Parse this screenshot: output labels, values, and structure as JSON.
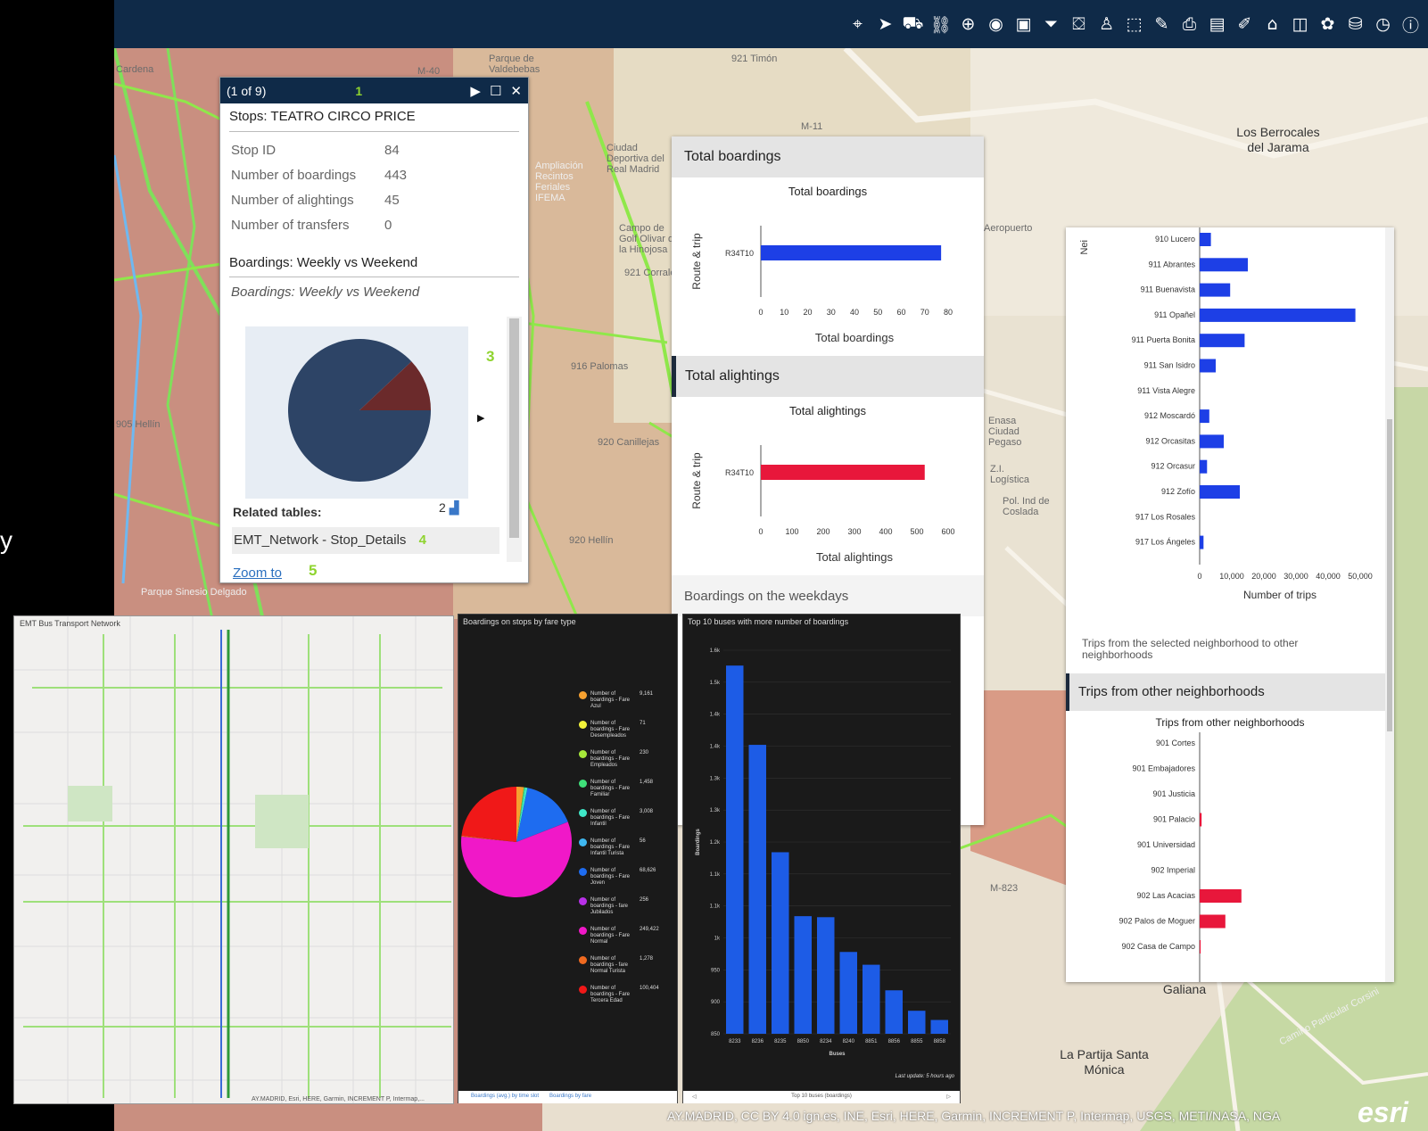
{
  "toolbar": {
    "icons": [
      "locate-icon",
      "directions-icon",
      "bus-icon",
      "link-icon",
      "add-icon",
      "bookmark-icon",
      "bus-stop-icon",
      "filter-icon",
      "transit-icon",
      "person-icon",
      "select-icon",
      "measure-icon",
      "print-icon",
      "table-icon",
      "edit-icon",
      "education-icon",
      "layer-icon",
      "basemap-icon",
      "stats-icon",
      "time-icon",
      "info-icon"
    ]
  },
  "map": {
    "labels": [
      "Cardena",
      "Parque de Valdebebas",
      "921 Timón",
      "M-40",
      "M-11",
      "Los Berrocales del Jarama",
      "Ampliación Recintos Feriales IFEMA",
      "Ciudad Deportiva del Real Madrid",
      "Campo de Golf Olivar de la Hinojosa",
      "921 Corralejos",
      "916 Palomas",
      "920 Canillejas",
      "920 Hellín",
      "905 Hellín",
      "Aeropuerto",
      "Enasa Ciudad Pegaso",
      "Z.I. Logística",
      "Pol. Ind de Coslada",
      "Real de la Galiana",
      "La Partija Santa Mónica",
      "Camino Particular Corsini",
      "Parque Sinesio Delgado",
      "M-823"
    ],
    "side_letter": "y"
  },
  "popup": {
    "counter": "(1 of 9)",
    "num1": "1",
    "title": "Stops: TEATRO CIRCO PRICE",
    "fields": [
      {
        "label": "Stop ID",
        "value": "84"
      },
      {
        "label": "Number of boardings",
        "value": "443"
      },
      {
        "label": "Number of alightings",
        "value": "45"
      },
      {
        "label": "Number of transfers",
        "value": "0"
      }
    ],
    "section": "Boardings: Weekly vs Weekend",
    "section_italic": "Boardings: Weekly vs Weekend",
    "num3": "3",
    "related_label": "Related tables:",
    "related_count": "2",
    "related_item": "EMT_Network - Stop_Details",
    "num4": "4",
    "zoom": "Zoom to",
    "num5": "5"
  },
  "mid_panel": {
    "boardings_header": "Total boardings",
    "boardings_chart_title": "Total boardings",
    "alightings_header": "Total alightings",
    "alightings_chart_title": "Total alightings",
    "weekdays_header": "Boardings on the weekdays",
    "ylabel": "Route & trip"
  },
  "right_panel": {
    "caption": "Trips from the selected neighborhood to other neighborhoods",
    "section2": "Trips from other neighborhoods",
    "section2_title": "Trips from other neighborhoods",
    "top_cut": "Nei"
  },
  "emt": {
    "title": "EMT Bus Transport Network",
    "attribution": "AY.MADRID, Esri, HERE, Garmin, INCREMENT P, Intermap,..."
  },
  "fare_panel": {
    "title": "Boardings on stops by fare type",
    "tab1": "Boardings (avg.) by time slot",
    "tab2": "Boardings by fare"
  },
  "top10_panel": {
    "title": "Top 10 buses with more number of boardings",
    "footer_update": "Last update: 5 hours ago",
    "footer_tab": "Top 10 buses (boardings)"
  },
  "attribution": "AY.MADRID, CC BY 4.0 ign.es, INE, Esri, HERE, Garmin, INCREMENT P, Intermap, USGS, METI/NASA, NGA",
  "esri": "esri",
  "colors": {
    "navy": "#0f2a48",
    "pie_main": "#2d4466",
    "pie_slice": "#6b2a2b",
    "blue": "#1d3fe6",
    "red": "#e8173b",
    "accent": "#8fd42f"
  },
  "chart_data": [
    {
      "type": "pie",
      "title": "Boardings: Weekly vs Weekend",
      "values": [
        88,
        12
      ],
      "colors": [
        "#2d4466",
        "#6b2a2b"
      ]
    },
    {
      "type": "bar",
      "orientation": "horizontal",
      "title": "Total boardings",
      "categories": [
        "R34T10"
      ],
      "values": [
        77
      ],
      "xlabel": "Total boardings",
      "ylabel": "Route & trip",
      "xlim": [
        0,
        80
      ],
      "ticks": [
        0,
        10,
        20,
        30,
        40,
        50,
        60,
        70,
        80
      ],
      "color": "#1d3fe6"
    },
    {
      "type": "bar",
      "orientation": "horizontal",
      "title": "Total alightings",
      "categories": [
        "R34T10"
      ],
      "values": [
        525
      ],
      "xlabel": "Total alightings",
      "ylabel": "Route & trip",
      "xlim": [
        0,
        600
      ],
      "ticks": [
        0,
        100,
        200,
        300,
        400,
        500,
        600
      ],
      "color": "#e8173b"
    },
    {
      "type": "bar",
      "orientation": "horizontal",
      "title": "",
      "categories": [
        "910 Lucero",
        "911 Abrantes",
        "911 Buenavista",
        "911 Opañel",
        "911 Puerta Bonita",
        "911 San Isidro",
        "911 Vista Alegre",
        "912 Moscardó",
        "912 Orcasitas",
        "912 Orcasur",
        "912 Zofío",
        "917 Los Rosales",
        "917 Los Ángeles"
      ],
      "values": [
        3500,
        15000,
        9500,
        48500,
        14000,
        5000,
        0,
        3000,
        7500,
        2300,
        12500,
        0,
        1200
      ],
      "xlabel": "Number of trips",
      "xlim": [
        0,
        50000
      ],
      "ticks": [
        "0",
        "10,000",
        "20,000",
        "30,000",
        "40,000",
        "50,000"
      ],
      "color": "#1d3fe6"
    },
    {
      "type": "bar",
      "orientation": "horizontal",
      "title": "Trips from other neighborhoods",
      "categories": [
        "901 Cortes",
        "901 Embajadores",
        "901 Justicia",
        "901 Palacio",
        "901 Universidad",
        "902 Imperial",
        "902 Las Acacias",
        "902 Palos de Moguer",
        "902 Casa de Campo"
      ],
      "values": [
        0,
        0,
        0,
        600,
        0,
        0,
        13000,
        8000,
        300
      ],
      "color": "#e8173b"
    },
    {
      "type": "pie",
      "title": "Boardings on stops by fare type",
      "series": [
        {
          "name": "Number of boardings - Fare Azul",
          "value": "9,161",
          "color": "#f5a030"
        },
        {
          "name": "Number of boardings - Fare Desempleados",
          "value": "71",
          "color": "#f2f23a"
        },
        {
          "name": "Number of boardings - Fare Empleados",
          "value": "230",
          "color": "#a6e83a"
        },
        {
          "name": "Number of boardings - Fare Familiar",
          "value": "1,458",
          "color": "#3fe07a"
        },
        {
          "name": "Number of boardings - Fare Infantil",
          "value": "3,008",
          "color": "#3fe8c8"
        },
        {
          "name": "Number of boardings - Fare Infantil Turista",
          "value": "56",
          "color": "#3fb8f0"
        },
        {
          "name": "Number of boardings - Fare Joven",
          "value": "68,626",
          "color": "#1e6cf0"
        },
        {
          "name": "Number of boardings - fare Jubilados",
          "value": "256",
          "color": "#b830e8"
        },
        {
          "name": "Number of boardings - Fare Normal",
          "value": "249,422",
          "color": "#f018c8"
        },
        {
          "name": "Number of boardings - fare Normal Turista",
          "value": "1,278",
          "color": "#f06a20"
        },
        {
          "name": "Number of boardings - Fare Tercera Edad",
          "value": "100,404",
          "color": "#f01818"
        }
      ]
    },
    {
      "type": "bar",
      "title": "Top 10 buses with more number of boardings",
      "categories": [
        "8233",
        "8236",
        "8235",
        "8850",
        "8234",
        "8240",
        "8851",
        "8856",
        "8855",
        "8858"
      ],
      "values": [
        1570,
        1415,
        1205,
        1080,
        1078,
        1010,
        985,
        935,
        895,
        877
      ],
      "xlabel": "Buses",
      "ylabel": "Boardings",
      "ylim": [
        850,
        1600
      ],
      "yticks": [
        "850",
        "900",
        "950",
        "1k",
        "1.1k",
        "1.1k",
        "1.2k",
        "1.3k",
        "1.3k",
        "1.4k",
        "1.4k",
        "1.5k",
        "1.6k"
      ],
      "color": "#1d5ce6"
    }
  ]
}
